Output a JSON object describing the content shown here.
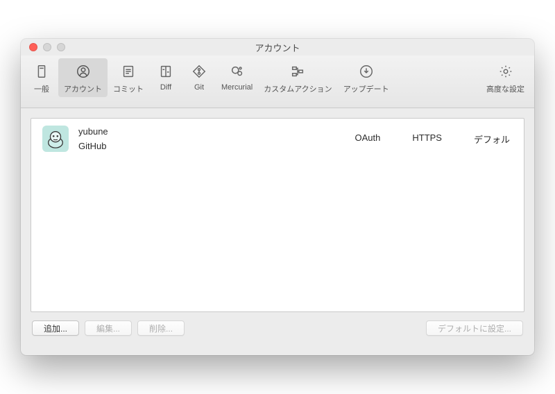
{
  "window": {
    "title": "アカウント"
  },
  "toolbar": {
    "items": [
      {
        "id": "general",
        "label": "一般"
      },
      {
        "id": "accounts",
        "label": "アカウント"
      },
      {
        "id": "commit",
        "label": "コミット"
      },
      {
        "id": "diff",
        "label": "Diff"
      },
      {
        "id": "git",
        "label": "Git"
      },
      {
        "id": "mercurial",
        "label": "Mercurial"
      },
      {
        "id": "customactions",
        "label": "カスタムアクション"
      },
      {
        "id": "update",
        "label": "アップデート"
      },
      {
        "id": "advanced",
        "label": "高度な設定"
      }
    ],
    "selected": "accounts"
  },
  "accounts": [
    {
      "username": "yubune",
      "host": "GitHub",
      "auth": "OAuth",
      "protocol": "HTTPS",
      "default_label": "デフォル"
    }
  ],
  "buttons": {
    "add": "追加...",
    "edit": "編集...",
    "remove": "削除...",
    "set_default": "デフォルトに設定..."
  }
}
